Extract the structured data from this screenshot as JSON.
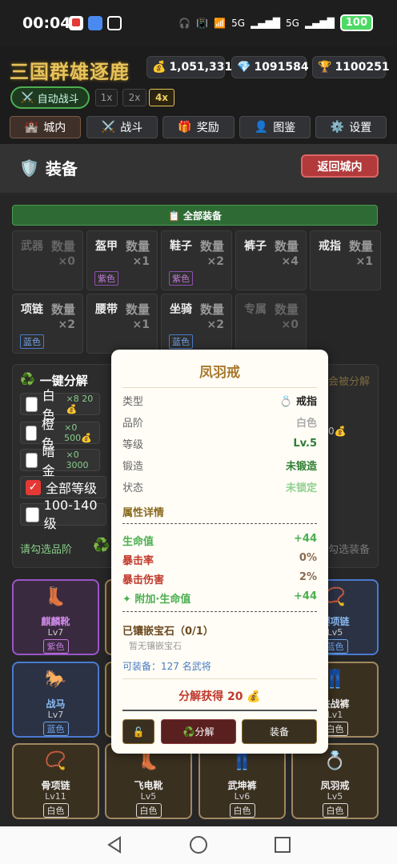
{
  "status_bar": {
    "time": "00:04",
    "network1": "5G",
    "network2": "5G",
    "battery": "100"
  },
  "header": {
    "title": "三国群雄逐鹿",
    "gold": "1,051,331",
    "diamond": "1091584",
    "trophy": "1100251",
    "auto_battle": "自动战斗",
    "speeds": [
      "1x",
      "2x",
      "4x"
    ],
    "nav": [
      {
        "icon": "🏰",
        "label": "城内"
      },
      {
        "icon": "⚔️",
        "label": "战斗"
      },
      {
        "icon": "🎁",
        "label": "奖励"
      },
      {
        "icon": "👤",
        "label": "图鉴"
      },
      {
        "icon": "⚙️",
        "label": "设置"
      }
    ]
  },
  "panel": {
    "icon": "🛡️",
    "title": "装备",
    "back": "返回城内"
  },
  "all_equipment": "📋 全部装备",
  "slots": [
    {
      "name": "武器",
      "qty_label": "数量",
      "count": "×0",
      "tag": ""
    },
    {
      "name": "盔甲",
      "qty_label": "数量",
      "count": "×1",
      "tag": "紫色"
    },
    {
      "name": "鞋子",
      "qty_label": "数量",
      "count": "×2",
      "tag": "紫色"
    },
    {
      "name": "裤子",
      "qty_label": "数量",
      "count": "×4",
      "tag": ""
    },
    {
      "name": "戒指",
      "qty_label": "数量",
      "count": "×1",
      "tag": ""
    },
    {
      "name": "项链",
      "qty_label": "数量",
      "count": "×2",
      "tag": "蓝色"
    },
    {
      "name": "腰带",
      "qty_label": "数量",
      "count": "×1",
      "tag": ""
    },
    {
      "name": "坐骑",
      "qty_label": "数量",
      "count": "×2",
      "tag": "蓝色"
    },
    {
      "name": "专属",
      "qty_label": "数量",
      "count": "×0",
      "tag": ""
    }
  ],
  "decompose": {
    "title": "一键分解",
    "right_hint": "会被分解",
    "rows": [
      {
        "label": "白色",
        "extra": "×8 20💰",
        "checked": false
      },
      {
        "label": "橙色",
        "extra": "×0 500💰",
        "checked": false
      },
      {
        "label": "暗金",
        "extra": "×0 3000",
        "checked": false
      },
      {
        "label": "全部等级",
        "extra": "",
        "checked": true
      },
      {
        "label": "100-140级",
        "extra": "",
        "checked": false
      }
    ],
    "right_value": "0💰",
    "bottom_left": "请勾选品阶",
    "bottom_right": "勾选装备"
  },
  "items": [
    {
      "name": "麒麟靴",
      "lv": "Lv7",
      "tag": "紫色",
      "icon": "👢",
      "q": "p"
    },
    {
      "name": "",
      "lv": "",
      "tag": "",
      "icon": "",
      "q": "w"
    },
    {
      "name": "",
      "lv": "",
      "tag": "",
      "icon": "",
      "q": "w"
    },
    {
      "name": "璎项链",
      "lv": "Lv5",
      "tag": "蓝色",
      "icon": "📿",
      "q": "b"
    },
    {
      "name": "战马",
      "lv": "Lv7",
      "tag": "蓝色",
      "icon": "🐎",
      "q": "b"
    },
    {
      "name": "",
      "lv": "",
      "tag": "",
      "icon": "",
      "q": "w"
    },
    {
      "name": "",
      "lv": "",
      "tag": "",
      "icon": "",
      "q": "w"
    },
    {
      "name": "铁战裤",
      "lv": "Lv1",
      "tag": "白色",
      "icon": "👖",
      "q": "w"
    },
    {
      "name": "骨项链",
      "lv": "Lv11",
      "tag": "白色",
      "icon": "📿",
      "q": "w"
    },
    {
      "name": "飞电靴",
      "lv": "Lv5",
      "tag": "白色",
      "icon": "👢",
      "q": "w"
    },
    {
      "name": "武坤裤",
      "lv": "Lv6",
      "tag": "白色",
      "icon": "👖",
      "q": "w"
    },
    {
      "name": "凤羽戒",
      "lv": "Lv5",
      "tag": "白色",
      "icon": "💍",
      "q": "w"
    }
  ],
  "popup": {
    "title": "凤羽戒",
    "rows": [
      {
        "k": "类型",
        "v": "💍 戒指",
        "color": "#222"
      },
      {
        "k": "品阶",
        "v": "白色",
        "color": "#aaa"
      },
      {
        "k": "等级",
        "v": "Lv.5",
        "color": "#2e7d32"
      },
      {
        "k": "锻造",
        "v": "未锻造",
        "color": "#2e7d32"
      },
      {
        "k": "状态",
        "v": "未锁定",
        "color": "#8fd18f"
      }
    ],
    "attr_title": "属性详情",
    "attrs": [
      {
        "k": "生命值",
        "v": "+44",
        "kc": "#4caf50",
        "vc": "#4caf50"
      },
      {
        "k": "暴击率",
        "v": "0%",
        "kc": "#c0392b",
        "vc": "#8a6a50"
      },
      {
        "k": "暴击伤害",
        "v": "2%",
        "kc": "#c0392b",
        "vc": "#8a6a50"
      },
      {
        "k": "✦ 附加·生命值",
        "v": "+44",
        "kc": "#4caf50",
        "vc": "#4caf50"
      }
    ],
    "gem_title": "已镶嵌宝石（0/1）",
    "gem_none": "暂无镶嵌宝石",
    "equip_count": "可装备：127 名武将",
    "decompose_gain": "分解获得 20 💰",
    "lock_icon": "🔓",
    "btn_decompose": "♻️分解",
    "btn_equip": "装备"
  }
}
